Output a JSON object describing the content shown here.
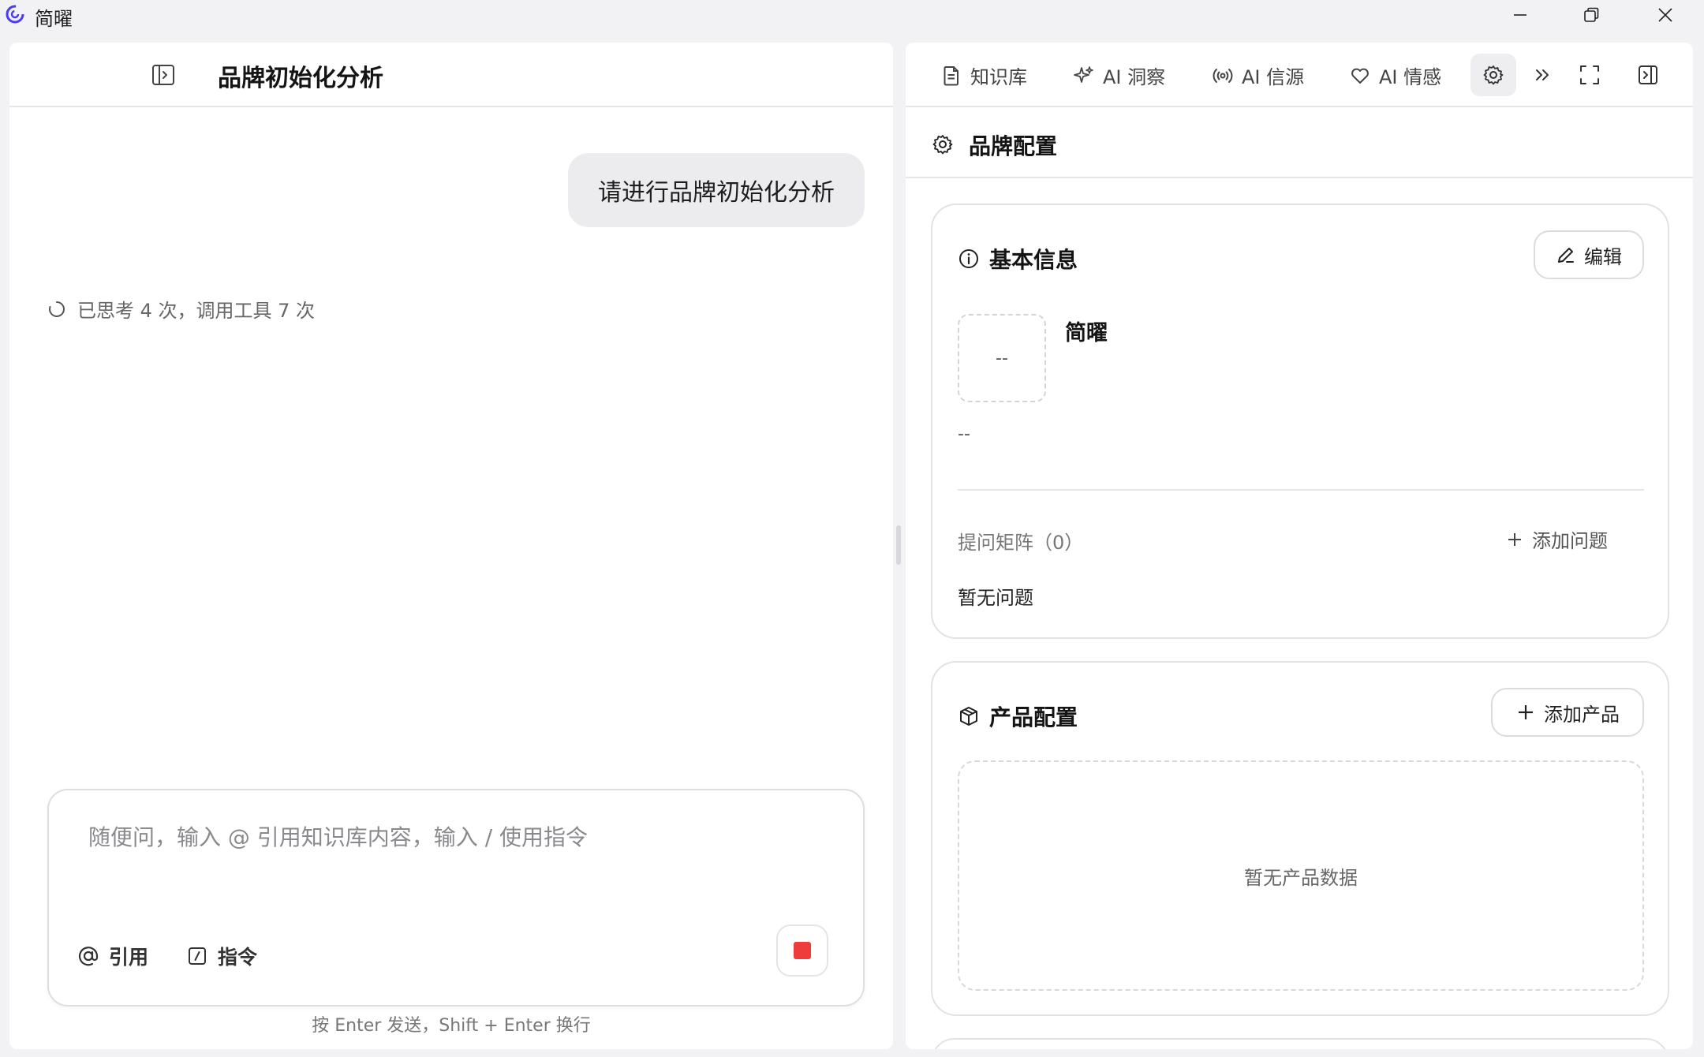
{
  "window": {
    "app_title": "简曜",
    "controls": {
      "minimize": "minimize-icon",
      "maximize": "restore-icon",
      "close": "close-icon"
    }
  },
  "chat": {
    "title": "品牌初始化分析",
    "user_message": "请进行品牌初始化分析",
    "thinking_status": "已思考 4 次，调用工具 7 次",
    "input_placeholder": "随便问，输入 @ 引用知识库内容，输入 / 使用指令",
    "tools": {
      "cite_label": "引用",
      "command_label": "指令"
    },
    "hint": "按 Enter 发送，Shift + Enter 换行",
    "stop_color": "#ef3b3b"
  },
  "tabs": [
    {
      "label": "知识库",
      "icon": "document-icon"
    },
    {
      "label": "AI 洞察",
      "icon": "sparkle-icon"
    },
    {
      "label": "AI 信源",
      "icon": "broadcast-icon"
    },
    {
      "label": "AI 情感",
      "icon": "heart-icon"
    }
  ],
  "active_tab_icon": "gear-icon",
  "brand_config": {
    "header": "品牌配置",
    "basic": {
      "title": "基本信息",
      "edit_label": "编辑",
      "logo_placeholder": "--",
      "brand_name": "简曜",
      "description": "--",
      "matrix_label": "提问矩阵（0）",
      "add_question_label": "添加问题",
      "empty_questions": "暂无问题"
    },
    "product": {
      "title": "产品配置",
      "add_product_label": "添加产品",
      "empty_text": "暂无产品数据"
    }
  }
}
